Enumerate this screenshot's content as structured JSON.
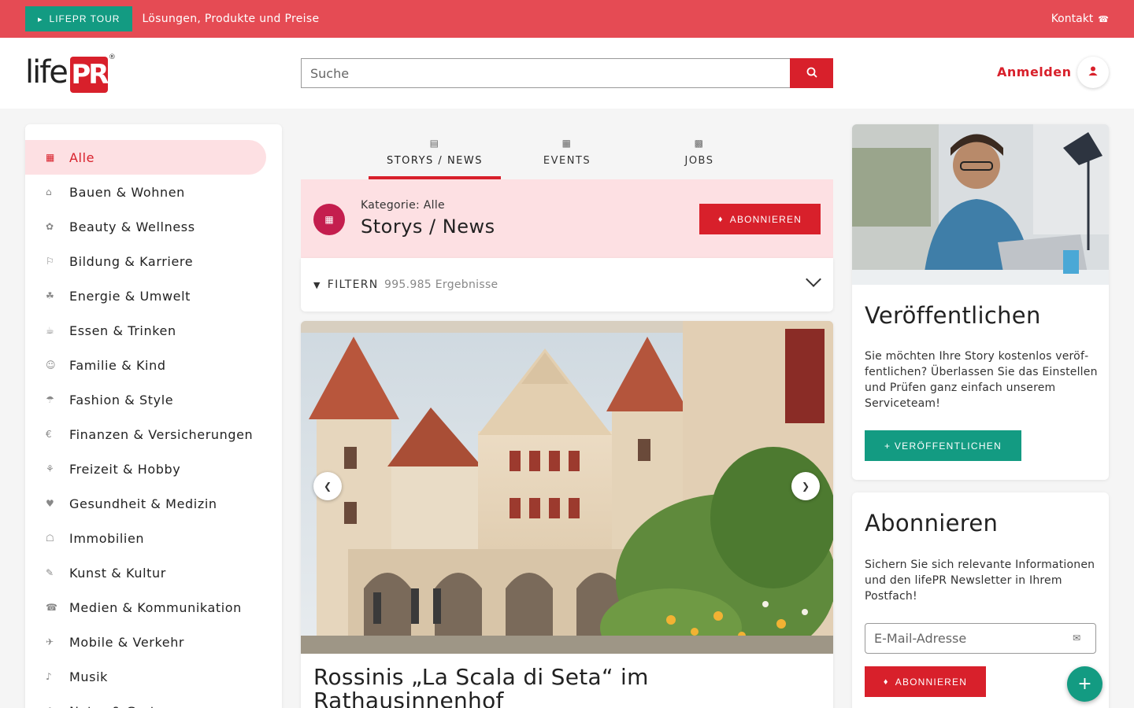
{
  "topbar": {
    "tour_label": "LIFEPR TOUR",
    "tour_icon": "map-icon",
    "link": "Lösungen, Produkte und Preise",
    "kontakt": "Kontakt",
    "kontakt_icon": "phone-icon"
  },
  "header": {
    "logo_text": "life",
    "logo_box": "PR",
    "logo_reg": "®",
    "search_placeholder": "Suche",
    "search_icon": "search-icon",
    "login": "Anmelden",
    "user_icon": "user-icon"
  },
  "sidebar": {
    "items": [
      {
        "label": "Alle",
        "icon": "grid-icon"
      },
      {
        "label": "Bauen & Wohnen",
        "icon": "house-icon"
      },
      {
        "label": "Beauty & Wellness",
        "icon": "spa-icon"
      },
      {
        "label": "Bildung & Karriere",
        "icon": "graduation-icon"
      },
      {
        "label": "Energie & Umwelt",
        "icon": "leaf-icon"
      },
      {
        "label": "Essen & Trinken",
        "icon": "utensils-icon"
      },
      {
        "label": "Familie & Kind",
        "icon": "child-icon"
      },
      {
        "label": "Fashion & Style",
        "icon": "shirt-icon"
      },
      {
        "label": "Finanzen & Versicherungen",
        "icon": "coins-icon"
      },
      {
        "label": "Freizeit & Hobby",
        "icon": "bicycle-icon"
      },
      {
        "label": "Gesundheit & Medizin",
        "icon": "heart-pulse-icon"
      },
      {
        "label": "Immobilien",
        "icon": "building-icon"
      },
      {
        "label": "Kunst & Kultur",
        "icon": "palette-icon"
      },
      {
        "label": "Medien & Kommunikation",
        "icon": "bullhorn-icon"
      },
      {
        "label": "Mobile & Verkehr",
        "icon": "car-icon"
      },
      {
        "label": "Musik",
        "icon": "music-icon"
      },
      {
        "label": "Natur & Garten",
        "icon": "tree-icon"
      }
    ]
  },
  "tabs": [
    {
      "label": "STORYS / NEWS",
      "icon": "newspaper-icon"
    },
    {
      "label": "EVENTS",
      "icon": "calendar-icon"
    },
    {
      "label": "JOBS",
      "icon": "briefcase-icon"
    }
  ],
  "category": {
    "sub": "Kategorie: Alle",
    "title": "Storys / News",
    "icon": "grid-icon",
    "subscribe": "ABONNIEREN",
    "subscribe_icon": "bell-icon"
  },
  "filter": {
    "label": "FILTERN",
    "count": "995.985 Ergebnisse",
    "icon": "filter-icon"
  },
  "story": {
    "title": "Rossinis „La Scala di Seta“ im Rathausinnenhof",
    "prev_icon": "chevron-left-icon",
    "next_icon": "chevron-right-icon"
  },
  "publish": {
    "title": "Veröffentlichen",
    "text": "Sie möchten Ihre Story kostenlos veröf­fentlichen? Überlassen Sie das Einstel­len und Prüfen ganz einfach unserem Serviceteam!",
    "button": "+  VERÖFFENTLICHEN"
  },
  "subscribe": {
    "title": "Abonnieren",
    "text": "Sichern Sie sich relevante Informatio­nen und den lifePR Newsletter in Ihrem Postfach!",
    "email_placeholder": "E-Mail-Adresse",
    "email_icon": "envelope-icon",
    "button": "ABONNIEREN",
    "button_icon": "bell-icon"
  },
  "fab": "+",
  "colors": {
    "brand_red": "#d8202b",
    "topbar": "#e54b54",
    "teal": "#139b82",
    "active_bg": "#fde0e3"
  }
}
